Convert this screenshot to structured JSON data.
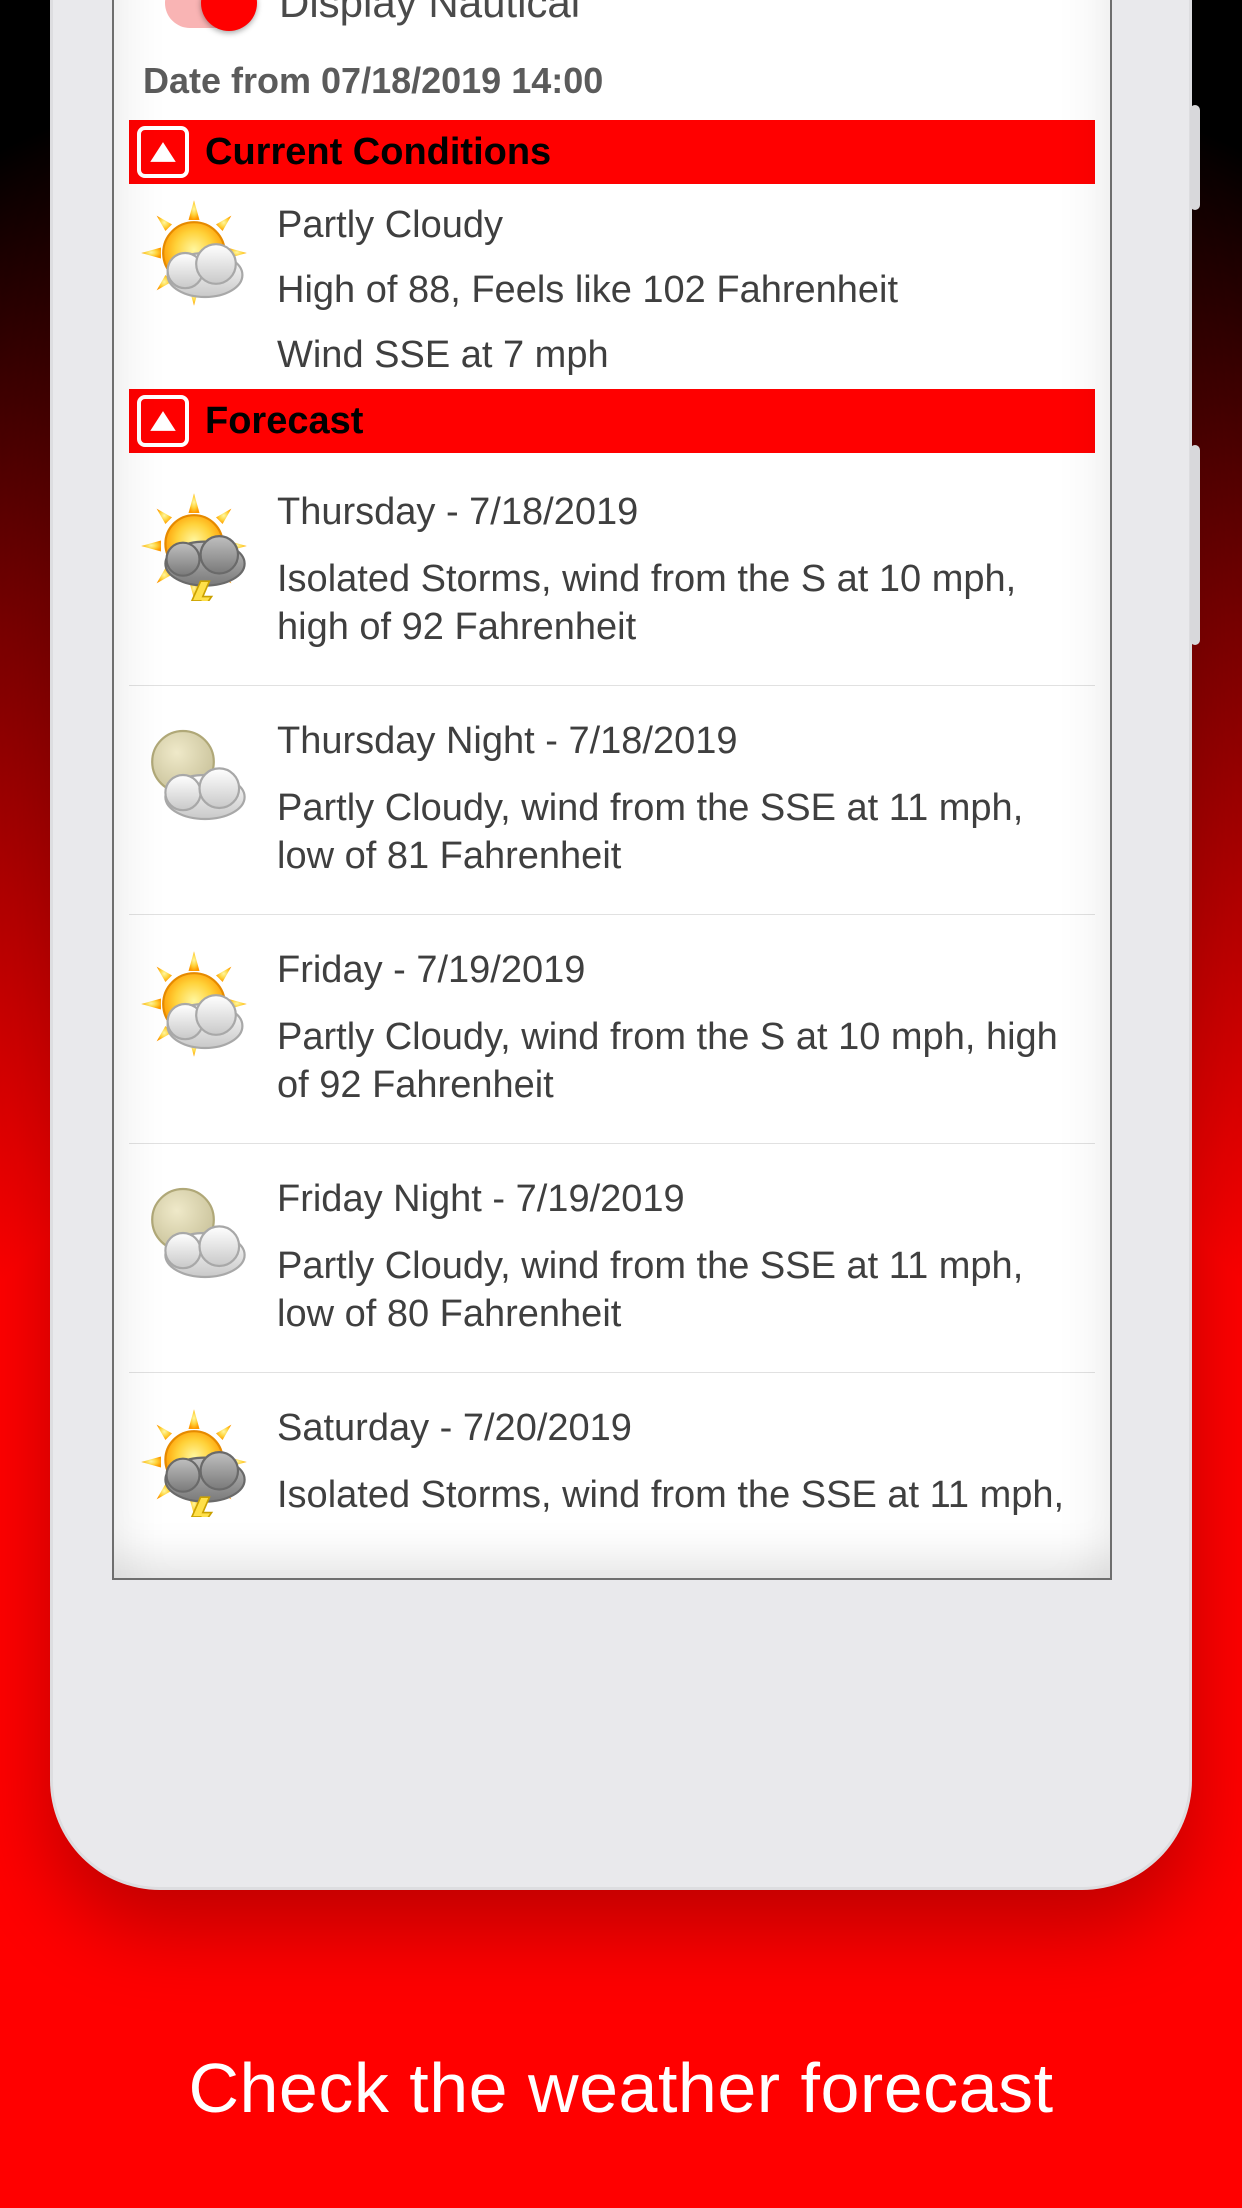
{
  "toggle": {
    "label": "Display Nautical",
    "on": true
  },
  "date_line": "Date from 07/18/2019 14:00",
  "sections": {
    "current": {
      "title": "Current Conditions"
    },
    "forecast": {
      "title": "Forecast"
    }
  },
  "current": {
    "summary": "Partly Cloudy",
    "high_feels": "High of 88, Feels like 102 Fahrenheit",
    "wind": "Wind SSE at 7 mph",
    "icon": "sun-cloud-icon"
  },
  "forecast_items": [
    {
      "title": "Thursday - 7/18/2019",
      "desc": "Isolated Storms, wind from the S at 10 mph, high of 92 Fahrenheit",
      "icon": "storm-icon"
    },
    {
      "title": "Thursday Night - 7/18/2019",
      "desc": "Partly Cloudy, wind from the SSE at 11 mph, low of 81 Fahrenheit",
      "icon": "moon-cloud-icon"
    },
    {
      "title": "Friday - 7/19/2019",
      "desc": "Partly Cloudy, wind from the S at 10 mph, high of 92 Fahrenheit",
      "icon": "sun-cloud-icon"
    },
    {
      "title": "Friday Night - 7/19/2019",
      "desc": "Partly Cloudy, wind from the SSE at 11 mph, low of 80 Fahrenheit",
      "icon": "moon-cloud-icon"
    },
    {
      "title": "Saturday - 7/20/2019",
      "desc": "Isolated Storms, wind from the SSE at 11 mph,",
      "icon": "storm-icon"
    }
  ],
  "caption": "Check the weather forecast",
  "colors": {
    "accent": "#ff0000"
  }
}
